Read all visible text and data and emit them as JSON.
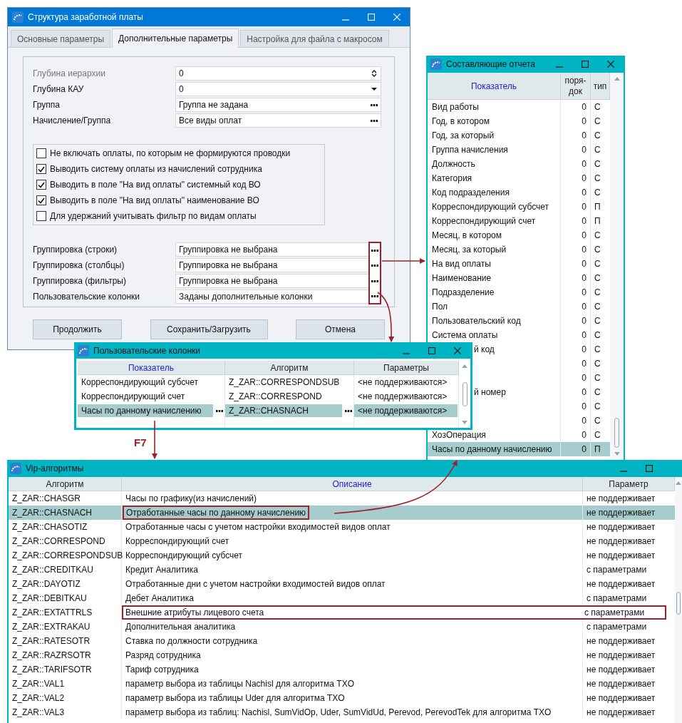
{
  "main_window": {
    "title": "Структура заработной платы",
    "tabs": [
      {
        "label": "Основные параметры",
        "selected": false
      },
      {
        "label": "Дополнительные параметры",
        "selected": true
      },
      {
        "label": "Настройка для файла с макросом",
        "selected": false
      }
    ],
    "fields": [
      {
        "label": "Глубина иерархии",
        "value": "0",
        "kind": "spin",
        "disabled": true
      },
      {
        "label": "Глубина КАУ",
        "value": "0",
        "kind": "dropdown",
        "disabled": false
      },
      {
        "label": "Группа",
        "value": "Группа не задана",
        "kind": "picker",
        "disabled": false
      },
      {
        "label": "Начисление/Группа",
        "value": "Все виды оплат",
        "kind": "picker",
        "disabled": false
      }
    ],
    "checkboxes": [
      {
        "label": "Не включать оплаты, по которым не формируются проводки",
        "checked": false
      },
      {
        "label": "Выводить систему оплаты из начислений сотрудника",
        "checked": true
      },
      {
        "label": "Выводить в поле \"На вид оплаты\" системный код ВО",
        "checked": true
      },
      {
        "label": "Выводить в поле \"На вид оплаты\" наименование ВО",
        "checked": true
      },
      {
        "label": "Для удержаний учитывать фильтр по видам оплаты",
        "checked": false
      }
    ],
    "grouping_fields": [
      {
        "label": "Группировка (строки)",
        "value": "Группировка не выбрана",
        "framed": true
      },
      {
        "label": "Группировка (столбцы)",
        "value": "Группировка не выбрана",
        "framed": true
      },
      {
        "label": "Группировка (фильтры)",
        "value": "Группировка не выбрана",
        "framed": true
      },
      {
        "label": "Пользовательские колонки",
        "value": "Заданы дополнительные колонки",
        "framed": true
      }
    ],
    "buttons": [
      "Продолжить",
      "Сохранить/Загрузить",
      "Отмена"
    ]
  },
  "report_components": {
    "title": "Составляющие отчета",
    "columns": [
      {
        "label": "Показатель",
        "sorted": true
      },
      {
        "label": "поря-док",
        "sorted": false
      },
      {
        "label": "тип",
        "sorted": false
      }
    ],
    "rows": [
      {
        "name": "Вид работы",
        "order": "0",
        "type": "С",
        "selected": false
      },
      {
        "name": "Год, в котором",
        "order": "0",
        "type": "С",
        "selected": false
      },
      {
        "name": "Год, за который",
        "order": "0",
        "type": "С",
        "selected": false
      },
      {
        "name": "Группа начисления",
        "order": "0",
        "type": "С",
        "selected": false
      },
      {
        "name": "Должность",
        "order": "0",
        "type": "С",
        "selected": false
      },
      {
        "name": "Категория",
        "order": "0",
        "type": "С",
        "selected": false
      },
      {
        "name": "Код подразделения",
        "order": "0",
        "type": "С",
        "selected": false
      },
      {
        "name": "Корреспондирующий субсчет",
        "order": "0",
        "type": "П",
        "selected": false
      },
      {
        "name": "Корреспондирующий счет",
        "order": "0",
        "type": "П",
        "selected": false
      },
      {
        "name": "Месяц, в котором",
        "order": "0",
        "type": "С",
        "selected": false
      },
      {
        "name": "Месяц, за который",
        "order": "0",
        "type": "С",
        "selected": false
      },
      {
        "name": "На вид оплаты",
        "order": "0",
        "type": "С",
        "selected": false
      },
      {
        "name": "Наименование",
        "order": "0",
        "type": "С",
        "selected": false
      },
      {
        "name": "Подразделение",
        "order": "0",
        "type": "С",
        "selected": false
      },
      {
        "name": "Пол",
        "order": "0",
        "type": "С",
        "selected": false
      },
      {
        "name": "Пользовательский код",
        "order": "0",
        "type": "С",
        "selected": false
      },
      {
        "name": "Система оплаты",
        "order": "0",
        "type": "С",
        "selected": false
      },
      {
        "name": "й код",
        "cut": true,
        "order": "0",
        "type": "С",
        "selected": false
      },
      {
        "order": "0",
        "type": "С",
        "selected": false
      },
      {
        "order": "0",
        "type": "С",
        "selected": false
      },
      {
        "name": "й номер",
        "cut": true,
        "order": "0",
        "type": "С",
        "selected": false
      },
      {
        "order": "0",
        "type": "С",
        "selected": false
      },
      {
        "order": "0",
        "type": "С",
        "selected": false
      },
      {
        "name": "ХозОперация",
        "order": "0",
        "type": "С",
        "selected": false
      },
      {
        "name": "Часы по данному начислению",
        "order": "0",
        "type": "П",
        "selected": true
      }
    ]
  },
  "user_columns": {
    "title": "Пользовательские колонки",
    "columns": [
      {
        "label": "Показатель",
        "sorted": true
      },
      {
        "label": "Алгоритм",
        "sorted": false
      },
      {
        "label": "Параметры",
        "sorted": false
      }
    ],
    "rows": [
      {
        "indicator": "Корреспондирующий субсчет",
        "algorithm": "Z_ZAR::CORRESPONDSUB",
        "params": "<не поддерживаются>",
        "selected": false
      },
      {
        "indicator": "Корреспондирующий счет",
        "algorithm": "Z_ZAR::CORRESPOND",
        "params": "<не поддерживаются>",
        "selected": false
      },
      {
        "indicator": "Часы по данному начислению",
        "algorithm": "Z_ZAR::CHASNACH",
        "params": "<не поддерживаются>",
        "selected": true
      }
    ]
  },
  "hotkey_label": "F7",
  "vip_algorithms": {
    "title": "Vip-алгоритмы",
    "columns": [
      {
        "label": "Алгоритм",
        "sorted": false
      },
      {
        "label": "Описание",
        "sorted": true
      },
      {
        "label": "Параметр",
        "sorted": false
      }
    ],
    "rows": [
      {
        "algorithm": "Z_ZAR::CHASGR",
        "description": "Часы по графику(из начислений)",
        "parameter": "не поддерживает",
        "selected": false
      },
      {
        "algorithm": "Z_ZAR::CHASNACH",
        "description": "Отработанные часы по данному начислению",
        "parameter": "не поддерживает",
        "selected": true,
        "description_framed": true,
        "parameter_framed": false
      },
      {
        "algorithm": "Z_ZAR::CHASOTIZ",
        "description": "Отработанные часы с учетом настройки входимостей видов оплат",
        "parameter": "не поддерживает",
        "selected": false
      },
      {
        "algorithm": "Z_ZAR::CORRESPOND",
        "description": "Корреспондирующий счет",
        "parameter": "не поддерживает",
        "selected": false
      },
      {
        "algorithm": "Z_ZAR::CORRESPONDSUB",
        "description": "Корреспондирующий субсчет",
        "parameter": "не поддерживает",
        "selected": false
      },
      {
        "algorithm": "Z_ZAR::CREDITKAU",
        "description": "Кредит Аналитика",
        "parameter": "с параметрами",
        "selected": false
      },
      {
        "algorithm": "Z_ZAR::DAYOTIZ",
        "description": "Отработанные дни с учетом настройки входимостей видов оплат",
        "parameter": "не поддерживает",
        "selected": false
      },
      {
        "algorithm": "Z_ZAR::DEBITKAU",
        "description": "Дебет Аналитика",
        "parameter": "с параметрами",
        "selected": false
      },
      {
        "algorithm": "Z_ZAR::EXTATTRLS",
        "description": "Внешние атрибуты лицевого счета",
        "parameter": "с параметрами",
        "selected": false,
        "description_framed": true,
        "parameter_framed": true
      },
      {
        "algorithm": "Z_ZAR::EXTRAKAU",
        "description": "Дополнительная аналитика",
        "parameter": "с параметрами",
        "selected": false
      },
      {
        "algorithm": "Z_ZAR::RATESOTR",
        "description": "Ставка по должности сотрудника",
        "parameter": "не поддерживает",
        "selected": false
      },
      {
        "algorithm": "Z_ZAR::RAZRSOTR",
        "description": "Разряд сотрудника",
        "parameter": "не поддерживает",
        "selected": false
      },
      {
        "algorithm": "Z_ZAR::TARIFSOTR",
        "description": "Тариф сотрудника",
        "parameter": "не поддерживает",
        "selected": false
      },
      {
        "algorithm": "Z_ZAR::VAL1",
        "description": "параметр выбора из таблицы Nachisl для алгоритма TXO",
        "parameter": "не поддерживает",
        "selected": false
      },
      {
        "algorithm": "Z_ZAR::VAL2",
        "description": "параметр выбора из таблицы Uder для алгоритма TXO",
        "parameter": "не поддерживает",
        "selected": false
      },
      {
        "algorithm": "Z_ZAR::VAL3",
        "description": "параметр выбора из таблиц: Nachisl, SumVidOp, Uder, SumVidUd, Perevod, PerevodTek для алгоритма TXO",
        "parameter": "не поддерживает",
        "selected": false
      }
    ]
  }
}
